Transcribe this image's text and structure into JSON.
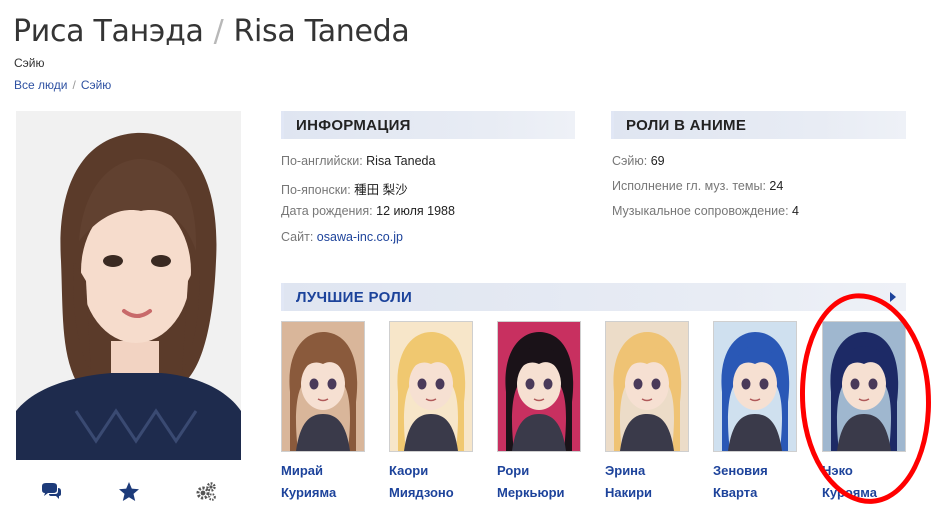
{
  "header": {
    "name_ru": "Риса Танэда",
    "separator": "/",
    "name_en": "Risa Taneda",
    "subtitle": "Сэйю"
  },
  "breadcrumb": {
    "items": [
      "Все люди",
      "Сэйю"
    ],
    "separator": "/"
  },
  "info": {
    "heading": "ИНФОРМАЦИЯ",
    "english_label": "По-английски:",
    "english_value": "Risa Taneda",
    "japanese_label": "По-японски:",
    "japanese_value": "種田 梨沙",
    "birth_label": "Дата рождения:",
    "birth_value": "12 июля 1988",
    "site_label": "Сайт:",
    "site_value": "osawa-inc.co.jp"
  },
  "anime_roles": {
    "heading": "РОЛИ В АНИМЕ",
    "seiyu_label": "Сэйю:",
    "seiyu_value": "69",
    "theme_label": "Исполнение гл. муз. темы:",
    "theme_value": "24",
    "music_label": "Музыкальное сопровождение:",
    "music_value": "4"
  },
  "best_roles": {
    "heading": "ЛУЧШИЕ РОЛИ",
    "items": [
      {
        "first": "Мирай",
        "last": "Курияма",
        "hair": "#8a5a3c",
        "bg": "#d9b69a"
      },
      {
        "first": "Каори",
        "last": "Миядзоно",
        "hair": "#f0c870",
        "bg": "#f7e6c9"
      },
      {
        "first": "Рори",
        "last": "Меркьюри",
        "hair": "#1a1218",
        "bg": "#c83060"
      },
      {
        "first": "Эрина",
        "last": "Накири",
        "hair": "#efc374",
        "bg": "#ecdcc8"
      },
      {
        "first": "Зеновия",
        "last": "Кварта",
        "hair": "#2a58b6",
        "bg": "#cfe0ef"
      },
      {
        "first": "Нэко",
        "last": "Курояма",
        "hair": "#1d2a66",
        "bg": "#9fb7cf"
      }
    ]
  },
  "colors": {
    "link": "#1d439b",
    "accent_circle": "#ff0000",
    "section_bg": "#e1e7f5"
  },
  "icons": [
    "comments-icon",
    "star-icon",
    "gears-icon",
    "chevron-right-icon"
  ]
}
